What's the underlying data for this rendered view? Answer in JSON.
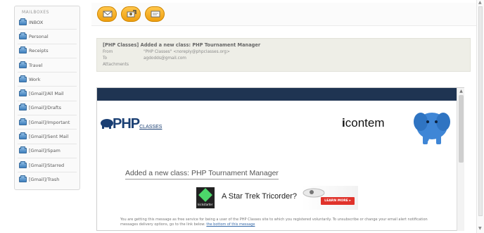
{
  "sidebar": {
    "title": "MAILBOXES",
    "folders": [
      {
        "label": "INBOX"
      },
      {
        "label": "Personal"
      },
      {
        "label": "Receipts"
      },
      {
        "label": "Travel"
      },
      {
        "label": "Work"
      },
      {
        "label": "[Gmail]/All Mail"
      },
      {
        "label": "[Gmail]/Drafts"
      },
      {
        "label": "[Gmail]/Important"
      },
      {
        "label": "[Gmail]/Sent Mail"
      },
      {
        "label": "[Gmail]/Spam"
      },
      {
        "label": "[Gmail]/Starred"
      },
      {
        "label": "[Gmail]/Trash"
      }
    ]
  },
  "toolbar": {
    "buttons": [
      {
        "icon": "envelope-icon"
      },
      {
        "icon": "envelope-attach-icon"
      },
      {
        "icon": "envelope-open-icon"
      }
    ]
  },
  "message": {
    "subject": "[PHP Classes] Added a new class: PHP Tournament Manager",
    "from_label": "From",
    "from_value": "\"PHP Classes\" <noreply@phpclasses.org>",
    "to_label": "To",
    "to_value": "agdodds@gmail.com",
    "attachments_label": "Attachments"
  },
  "body": {
    "php_logo_text": "PHP",
    "php_logo_sub": "CLASSES",
    "icontem_logo_i": "i",
    "icontem_logo_rest": "contem",
    "headline": "Added a new class: PHP Tournament Manager",
    "ad": {
      "brand": "kickstarter",
      "text": "A Star Trek Tricorder?",
      "cta": "LEARN MORE ▸"
    },
    "footer_text": "You are getting this message as free service for being a user of the PHP Classes site to which you registered voluntarily. To unsubscribe or change your email alert notification messages delivery options, go to the link below:",
    "footer_link": "the bottom of this message"
  },
  "colors": {
    "toolbar_button": "#f0a41a",
    "header_bg": "#eeeee7",
    "navy_bar": "#1f3452",
    "php_blue": "#1a3f73",
    "ad_cta": "#e0322a"
  }
}
